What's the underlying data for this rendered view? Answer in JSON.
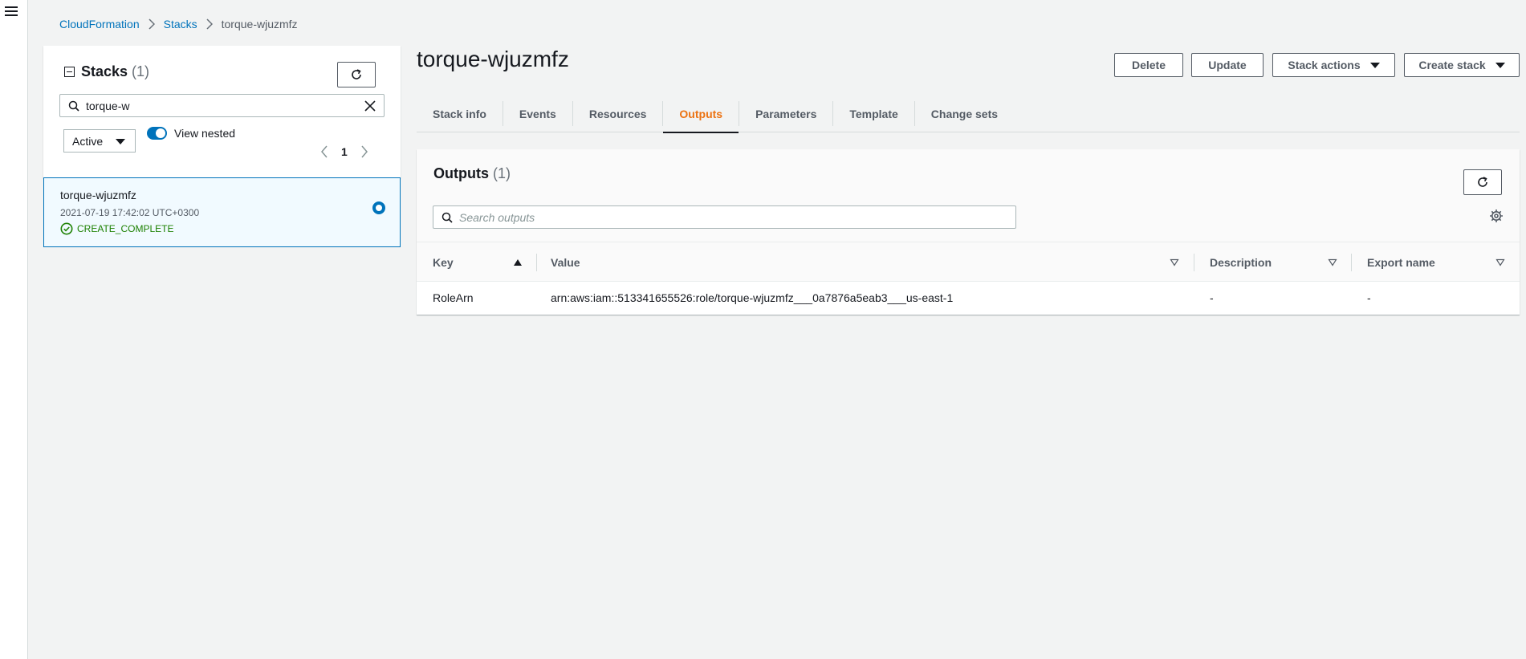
{
  "breadcrumb": {
    "root": "CloudFormation",
    "section": "Stacks",
    "current": "torque-wjuzmfz"
  },
  "stacks_panel": {
    "title": "Stacks",
    "count": "(1)",
    "search_value": "torque-w",
    "filter_selected": "Active",
    "view_nested_label": "View nested",
    "view_nested_on": true,
    "page_number": "1",
    "stacks": [
      {
        "name": "torque-wjuzmfz",
        "created": "2021-07-19 17:42:02 UTC+0300",
        "status": "CREATE_COMPLETE",
        "selected": true
      }
    ]
  },
  "detail": {
    "title": "torque-wjuzmfz",
    "buttons": {
      "delete": "Delete",
      "update": "Update",
      "stack_actions": "Stack actions",
      "create_stack": "Create stack"
    },
    "tabs": [
      "Stack info",
      "Events",
      "Resources",
      "Outputs",
      "Parameters",
      "Template",
      "Change sets"
    ],
    "active_tab": "Outputs"
  },
  "outputs": {
    "title": "Outputs",
    "count": "(1)",
    "search_placeholder": "Search outputs",
    "columns": [
      "Key",
      "Value",
      "Description",
      "Export name"
    ],
    "rows": [
      {
        "key": "RoleArn",
        "value": "arn:aws:iam::513341655526:role/torque-wjuzmfz___0a7876a5eab3___us-east-1",
        "description": "-",
        "export_name": "-"
      }
    ]
  },
  "colors": {
    "link": "#0073bb",
    "active_tab": "#ec7211",
    "success": "#1d8102",
    "selection_bg": "#f1faff"
  }
}
